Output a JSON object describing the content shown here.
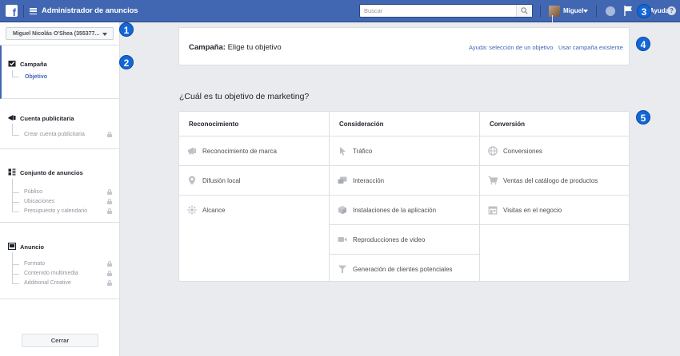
{
  "topbar": {
    "title": "Administrador de anuncios",
    "search_placeholder": "Buscar",
    "user_name": "Miguel",
    "help_label": "Ayuda"
  },
  "sidebar": {
    "account": "Miguel Nicolás O'Shea (355377...",
    "sections": [
      {
        "title": "Campaña",
        "items": [
          {
            "label": "Objetivo"
          }
        ]
      },
      {
        "title": "Cuenta publicitaria",
        "items": [
          {
            "label": "Crear cuenta publicitaria"
          }
        ]
      },
      {
        "title": "Conjunto de anuncios",
        "items": [
          {
            "label": "Público"
          },
          {
            "label": "Ubicaciones"
          },
          {
            "label": "Presupuesto y calendario"
          }
        ]
      },
      {
        "title": "Anuncio",
        "items": [
          {
            "label": "Formato"
          },
          {
            "label": "Contenido multimedia"
          },
          {
            "label": "Additional Creative"
          }
        ]
      }
    ],
    "close_label": "Cerrar"
  },
  "callouts": [
    "1",
    "2",
    "3",
    "4",
    "5"
  ],
  "header": {
    "title_bold": "Campaña:",
    "title_rest": " Elige tu objetivo",
    "help_link": "Ayuda: selección de un objetivo",
    "existing_link": "Usar campaña existente"
  },
  "question": "¿Cuál es tu objetivo de marketing?",
  "columns": [
    {
      "title": "Reconocimiento",
      "options": [
        {
          "label": "Reconocimiento de marca",
          "icon": "megaphone-icon"
        },
        {
          "label": "Difusión local",
          "icon": "location-pin-icon"
        },
        {
          "label": "Alcance",
          "icon": "reach-burst-icon"
        }
      ]
    },
    {
      "title": "Consideración",
      "options": [
        {
          "label": "Tráfico",
          "icon": "cursor-icon"
        },
        {
          "label": "Interacción",
          "icon": "chat-bubbles-icon"
        },
        {
          "label": "Instalaciones de la aplicación",
          "icon": "box-icon"
        },
        {
          "label": "Reproducciones de video",
          "icon": "video-camera-icon"
        },
        {
          "label": "Generación de clientes potenciales",
          "icon": "funnel-icon"
        }
      ]
    },
    {
      "title": "Conversión",
      "options": [
        {
          "label": "Conversiones",
          "icon": "globe-icon"
        },
        {
          "label": "Ventas del catálogo de productos",
          "icon": "shopping-cart-icon"
        },
        {
          "label": "Visitas en el negocio",
          "icon": "storefront-icon"
        }
      ]
    }
  ]
}
